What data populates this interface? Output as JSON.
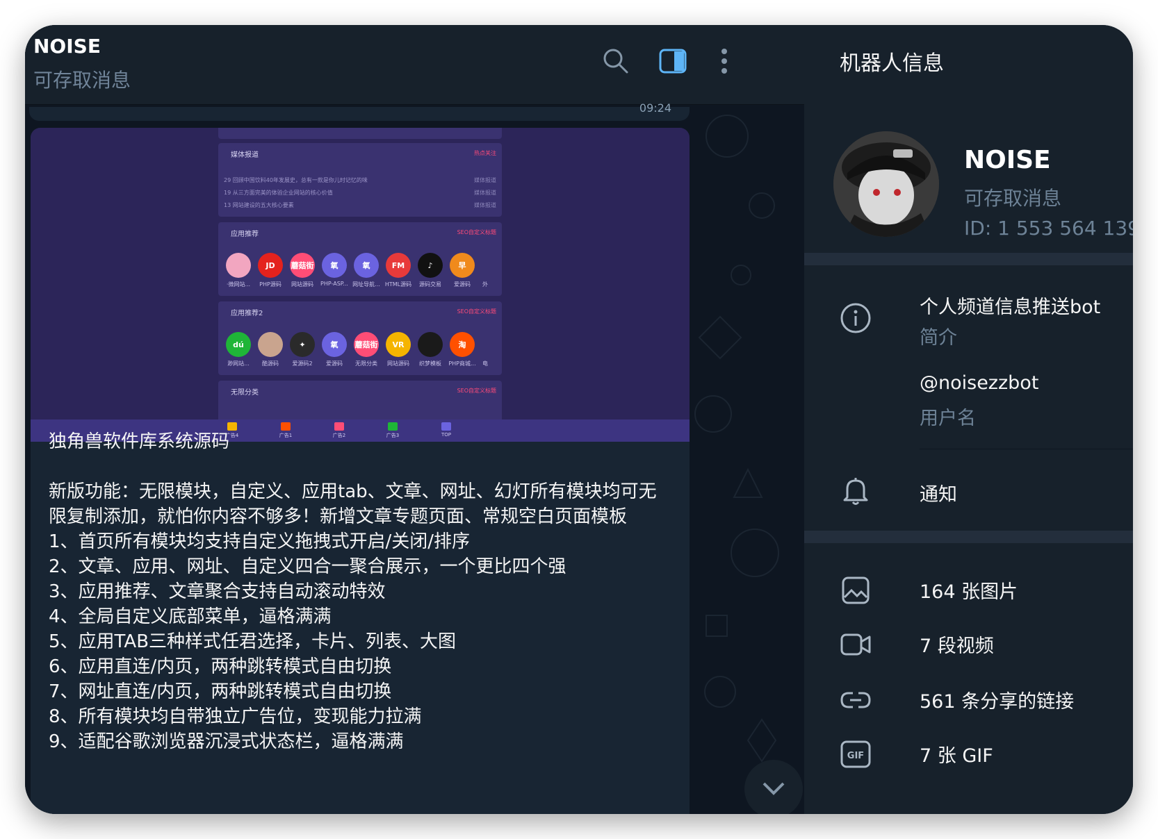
{
  "chat": {
    "title": "NOISE",
    "subtitle": "可存取消息",
    "prev_time": "09:24",
    "header_icons": [
      "search-icon",
      "sidebar-toggle-icon",
      "more-vertical-icon"
    ],
    "message": "独角兽软件库系统源码\n\n新版功能：无限模块，自定义、应用tab、文章、网址、幻灯所有模块均可无限复制添加，就怕你内容不够多！新增文章专题页面、常规空白页面模板\n1、首页所有模块均支持自定义拖拽式开启/关闭/排序\n2、文章、应用、网址、自定义四合一聚合展示，一个更比四个强\n3、应用推荐、文章聚合支持自动滚动特效\n4、全局自定义底部菜单，逼格满满\n5、应用TAB三种样式任君选择，卡片、列表、大图\n6、应用直连/内页，两种跳转模式自由切换\n7、网址直连/内页，两种跳转模式自由切换\n8、所有模块均自带独立广告位，变现能力拉满\n9、适配谷歌浏览器沉浸式状态栏，逼格满满",
    "preview": {
      "news": {
        "title": "媒体报道",
        "tag": "热点关注",
        "items": [
          {
            "num": "29",
            "text": "回顾中国饮料40年发展史，总有一款是你儿时记忆的味",
            "src": "媒体报道"
          },
          {
            "num": "19",
            "text": "从三方面完美的体验企业网站的核心价值",
            "src": "媒体报道"
          },
          {
            "num": "13",
            "text": "网站建设的五大核心要素",
            "src": "媒体报道"
          }
        ]
      },
      "apps1": {
        "title": "应用推荐",
        "tag": "SEO自定义标题",
        "items": [
          {
            "icon": "",
            "label": "·微网站...",
            "color": "#f2a6c0"
          },
          {
            "icon": "JD",
            "label": "PHP源码",
            "color": "#e4221d"
          },
          {
            "icon": "蘑菇街",
            "label": "网站源码",
            "color": "#ff4d76"
          },
          {
            "icon": "氧",
            "label": "PHP-ASP...",
            "color": "#6b63e0"
          },
          {
            "icon": "氧",
            "label": "网址导航...",
            "color": "#6b63e0"
          },
          {
            "icon": "FM",
            "label": "HTML源码",
            "color": "#e83a3a"
          },
          {
            "icon": "♪",
            "label": "源码交易",
            "color": "#111111"
          },
          {
            "icon": "早",
            "label": "爱源码",
            "color": "#f08a1c"
          }
        ],
        "more": "外"
      },
      "apps2": {
        "title": "应用推荐2",
        "tag": "SEO自定义标题",
        "items": [
          {
            "icon": "dú",
            "label": "渺网站...",
            "color": "#1fb538"
          },
          {
            "icon": "",
            "label": "酷源码",
            "color": "#c9a48e"
          },
          {
            "icon": "✦",
            "label": "爱源码2",
            "color": "#2a2a2a"
          },
          {
            "icon": "氧",
            "label": "爱源码",
            "color": "#6b63e0"
          },
          {
            "icon": "蘑菇街",
            "label": "无限分类",
            "color": "#ff4d76"
          },
          {
            "icon": "VR",
            "label": "网站源码",
            "color": "#f5b400"
          },
          {
            "icon": "",
            "label": "织梦模板",
            "color": "#1a1a1a"
          },
          {
            "icon": "淘",
            "label": "PHP商城...",
            "color": "#ff5000"
          }
        ],
        "more": "电"
      },
      "apps3": {
        "title": "无限分类",
        "tag": "SEO自定义标题"
      },
      "bottom_bar": [
        {
          "label": "广告4",
          "color": "#f5b400"
        },
        {
          "label": "广告1",
          "color": "#ff5000"
        },
        {
          "label": "广告2",
          "color": "#ff4d76"
        },
        {
          "label": "广告3",
          "color": "#1fb538"
        },
        {
          "label": "TOP",
          "color": "#6b63e0"
        }
      ]
    }
  },
  "info": {
    "title": "机器人信息",
    "name": "NOISE",
    "subtitle": "可存取消息",
    "id_text": "ID: 1 553 564 139",
    "bio": "个人频道信息推送bot",
    "bio_label": "简介",
    "username": "@noisezzbot",
    "username_label": "用户名",
    "notifications": "通知",
    "media": [
      {
        "icon": "photo-icon",
        "label": "164 张图片"
      },
      {
        "icon": "video-icon",
        "label": "7 段视频"
      },
      {
        "icon": "link-icon",
        "label": "561 条分享的链接"
      },
      {
        "icon": "gif-icon",
        "label": "7 张 GIF"
      }
    ]
  },
  "colors": {
    "accent": "#5eb5f7",
    "panel_bg": "#17212b",
    "chat_bg": "#0e1621",
    "muted": "#6d8296"
  }
}
